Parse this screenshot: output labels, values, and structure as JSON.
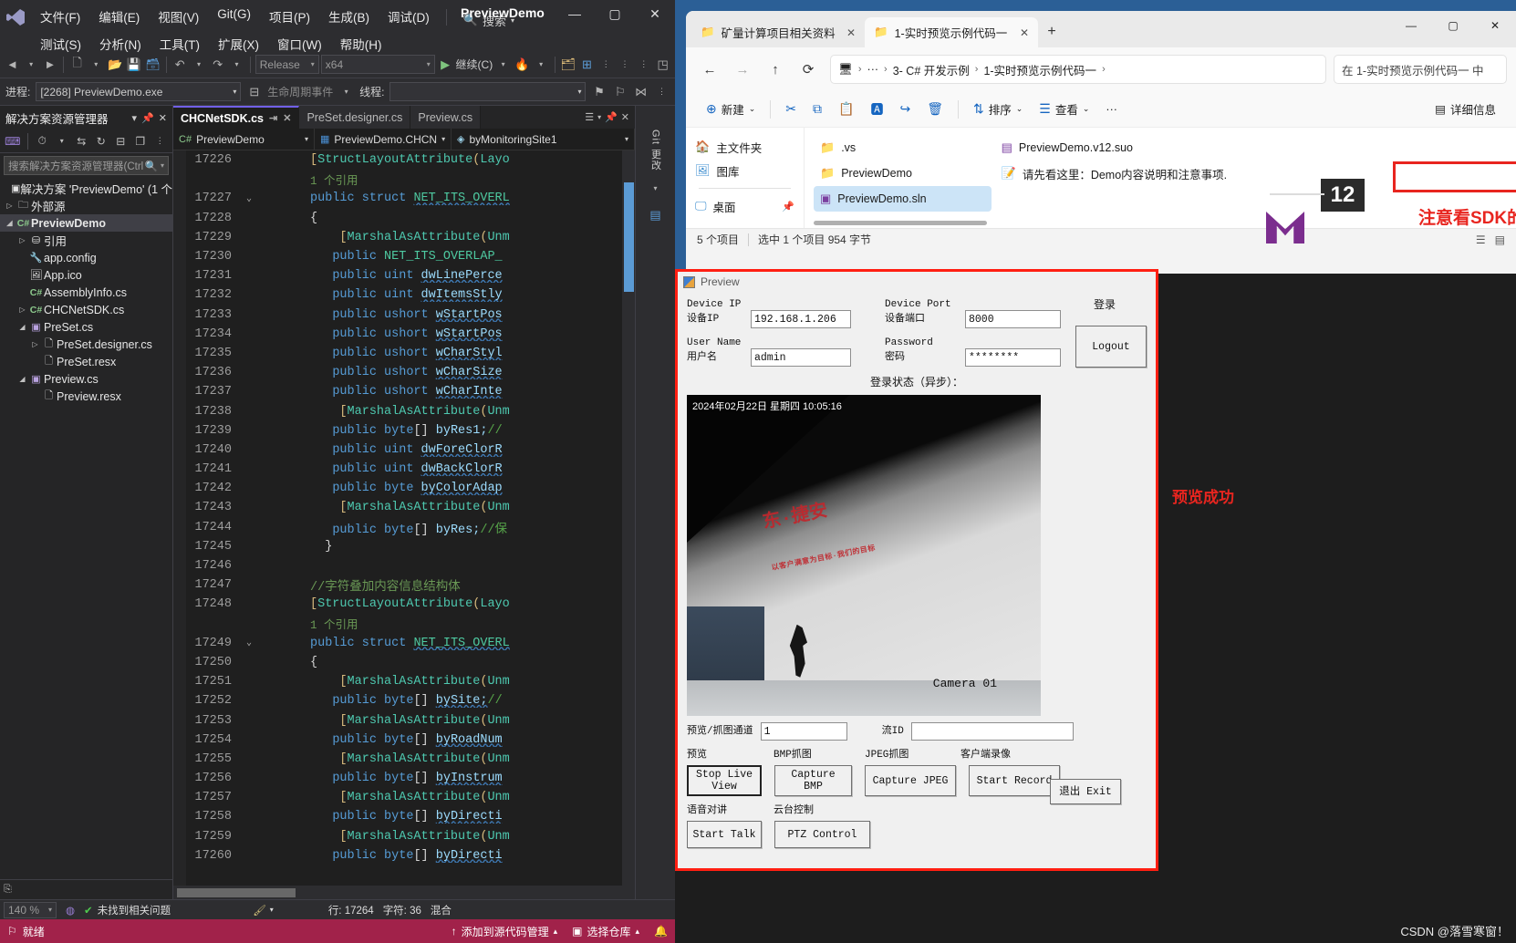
{
  "vs": {
    "title": "PreviewDemo",
    "menus_row1": [
      "文件(F)",
      "编辑(E)",
      "视图(V)",
      "Git(G)",
      "项目(P)",
      "生成(B)",
      "调试(D)"
    ],
    "menus_row2": [
      "测试(S)",
      "分析(N)",
      "工具(T)",
      "扩展(X)",
      "窗口(W)",
      "帮助(H)"
    ],
    "search_label": "搜索",
    "window_buttons": {
      "minimize": "—",
      "maximize": "▢",
      "close": "✕"
    },
    "toolbar": {
      "config": "Release",
      "platform": "x64",
      "run_label": "继续(C)",
      "process_label": "进程:",
      "process_value": "[2268] PreviewDemo.exe",
      "lifecycle_label": "生命周期事件",
      "thread_label": "线程:"
    },
    "solution_explorer": {
      "title": "解决方案资源管理器",
      "search_placeholder": "搜索解决方案资源管理器(Ctrl",
      "tree": [
        {
          "label": "解决方案 'PreviewDemo' (1 个",
          "depth": 0,
          "arrow": "",
          "icon": "solution-icon",
          "selected": false
        },
        {
          "label": "外部源",
          "depth": 0,
          "arrow": "▷",
          "icon": "external-icon",
          "selected": false
        },
        {
          "label": "PreviewDemo",
          "depth": 0,
          "arrow": "◢",
          "icon": "csharp-icon",
          "selected": true
        },
        {
          "label": "引用",
          "depth": 1,
          "arrow": "▷",
          "icon": "references-icon",
          "selected": false
        },
        {
          "label": "app.config",
          "depth": 1,
          "arrow": "",
          "icon": "config-icon",
          "selected": false
        },
        {
          "label": "App.ico",
          "depth": 1,
          "arrow": "",
          "icon": "image-icon",
          "selected": false
        },
        {
          "label": "AssemblyInfo.cs",
          "depth": 1,
          "arrow": "",
          "icon": "csharp-icon",
          "selected": false
        },
        {
          "label": "CHCNetSDK.cs",
          "depth": 1,
          "arrow": "▷",
          "icon": "csharp-icon",
          "selected": false
        },
        {
          "label": "PreSet.cs",
          "depth": 1,
          "arrow": "◢",
          "icon": "form-icon",
          "selected": false
        },
        {
          "label": "PreSet.designer.cs",
          "depth": 2,
          "arrow": "▷",
          "icon": "file-icon",
          "selected": false
        },
        {
          "label": "PreSet.resx",
          "depth": 2,
          "arrow": "",
          "icon": "file-icon",
          "selected": false
        },
        {
          "label": "Preview.cs",
          "depth": 1,
          "arrow": "◢",
          "icon": "form-icon",
          "selected": false
        },
        {
          "label": "Preview.resx",
          "depth": 2,
          "arrow": "",
          "icon": "file-icon",
          "selected": false
        }
      ]
    },
    "editor": {
      "tabs": [
        {
          "label": "CHCNetSDK.cs",
          "active": true
        },
        {
          "label": "PreSet.designer.cs",
          "active": false
        },
        {
          "label": "Preview.cs",
          "active": false
        }
      ],
      "nav": [
        {
          "label": "PreviewDemo",
          "icon": "csharp-icon"
        },
        {
          "label": "PreviewDemo.CHCN",
          "icon": "class-icon"
        },
        {
          "label": "byMonitoringSite1",
          "icon": "field-icon"
        }
      ],
      "zoom": "140 %",
      "issues": "未找到相关问题",
      "line_label": "行: 17264",
      "char_label": "字符: 36",
      "mode_label": "混合",
      "lines": [
        {
          "n": "17226",
          "fold": "",
          "html": "<span class='k-yellow'>[</span><span class='k-teal'>StructLayoutAttribute</span><span class='k-yellow'>(</span><span class='k-teal'>Layo</span>"
        },
        {
          "n": "",
          "fold": "",
          "html": "<span class='ref-lens'>1 个引用</span>"
        },
        {
          "n": "17227",
          "fold": "⌄",
          "html": "<span class='k-blue'>public</span> <span class='k-blue'>struct</span> <span class='k-green squig'>NET_ITS_OVERL</span>"
        },
        {
          "n": "17228",
          "fold": "",
          "html": "<span class='k-white'>{</span>"
        },
        {
          "n": "17229",
          "fold": "",
          "html": "    <span class='k-yellow'>[</span><span class='k-teal'>MarshalAsAttribute</span><span class='k-yellow'>(</span><span class='k-teal'>Unm</span>"
        },
        {
          "n": "17230",
          "fold": "",
          "html": "   <span class='k-blue'>public</span> <span class='k-green'>NET_ITS_OVERLAP_</span>"
        },
        {
          "n": "17231",
          "fold": "",
          "html": "   <span class='k-blue'>public</span> <span class='k-blue'>uint</span> <span class='k-var squig'>dwLinePerce</span>"
        },
        {
          "n": "17232",
          "fold": "",
          "html": "   <span class='k-blue'>public</span> <span class='k-blue'>uint</span> <span class='k-var squig'>dwItemsStly</span>"
        },
        {
          "n": "17233",
          "fold": "",
          "html": "   <span class='k-blue'>public</span> <span class='k-blue'>ushort</span> <span class='k-var squig'>wStartPos</span>"
        },
        {
          "n": "17234",
          "fold": "",
          "html": "   <span class='k-blue'>public</span> <span class='k-blue'>ushort</span> <span class='k-var squig'>wStartPos</span>"
        },
        {
          "n": "17235",
          "fold": "",
          "html": "   <span class='k-blue'>public</span> <span class='k-blue'>ushort</span> <span class='k-var squig'>wCharStyl</span>"
        },
        {
          "n": "17236",
          "fold": "",
          "html": "   <span class='k-blue'>public</span> <span class='k-blue'>ushort</span> <span class='k-var squig'>wCharSize</span>"
        },
        {
          "n": "17237",
          "fold": "",
          "html": "   <span class='k-blue'>public</span> <span class='k-blue'>ushort</span> <span class='k-var squig'>wCharInte</span>"
        },
        {
          "n": "17238",
          "fold": "",
          "html": "    <span class='k-yellow'>[</span><span class='k-teal'>MarshalAsAttribute</span><span class='k-yellow'>(</span><span class='k-teal'>Unm</span>"
        },
        {
          "n": "17239",
          "fold": "",
          "html": "   <span class='k-blue'>public</span> <span class='k-blue'>byte</span><span class='k-white'>[]</span> <span class='k-var'>byRes1;</span><span class='k-lgreen'>//</span>"
        },
        {
          "n": "17240",
          "fold": "",
          "html": "   <span class='k-blue'>public</span> <span class='k-blue'>uint</span> <span class='k-var squig'>dwForeClorR</span>"
        },
        {
          "n": "17241",
          "fold": "",
          "html": "   <span class='k-blue'>public</span> <span class='k-blue'>uint</span> <span class='k-var squig'>dwBackClorR</span>"
        },
        {
          "n": "17242",
          "fold": "",
          "html": "   <span class='k-blue'>public</span> <span class='k-blue'>byte</span> <span class='k-var squig'>byColorAdap</span>"
        },
        {
          "n": "17243",
          "fold": "",
          "html": "    <span class='k-yellow'>[</span><span class='k-teal'>MarshalAsAttribute</span><span class='k-yellow'>(</span><span class='k-teal'>Unm</span>"
        },
        {
          "n": "17244",
          "fold": "",
          "html": "   <span class='k-blue'>public</span> <span class='k-blue'>byte</span><span class='k-white'>[]</span> <span class='k-var'>byRes;</span><span class='k-lgreen'>//保</span>"
        },
        {
          "n": "17245",
          "fold": "",
          "html": "  <span class='k-white'>}</span>"
        },
        {
          "n": "17246",
          "fold": "",
          "html": ""
        },
        {
          "n": "17247",
          "fold": "",
          "html": "<span class='k-com'>//字符叠加内容信息结构体</span>"
        },
        {
          "n": "17248",
          "fold": "",
          "html": "<span class='k-yellow'>[</span><span class='k-teal'>StructLayoutAttribute</span><span class='k-yellow'>(</span><span class='k-teal'>Layo</span>"
        },
        {
          "n": "",
          "fold": "",
          "html": "<span class='ref-lens'>1 个引用</span>"
        },
        {
          "n": "17249",
          "fold": "⌄",
          "html": "<span class='k-blue'>public</span> <span class='k-blue'>struct</span> <span class='k-green squig'>NET_ITS_OVERL</span>"
        },
        {
          "n": "17250",
          "fold": "",
          "html": "<span class='k-white'>{</span>"
        },
        {
          "n": "17251",
          "fold": "",
          "html": "    <span class='k-yellow'>[</span><span class='k-teal'>MarshalAsAttribute</span><span class='k-yellow'>(</span><span class='k-teal'>Unm</span>"
        },
        {
          "n": "17252",
          "fold": "",
          "html": "   <span class='k-blue'>public</span> <span class='k-blue'>byte</span><span class='k-white'>[]</span> <span class='k-var squig'>bySite;</span><span class='k-lgreen'>//</span>"
        },
        {
          "n": "17253",
          "fold": "",
          "html": "    <span class='k-yellow'>[</span><span class='k-teal'>MarshalAsAttribute</span><span class='k-yellow'>(</span><span class='k-teal'>Unm</span>"
        },
        {
          "n": "17254",
          "fold": "",
          "html": "   <span class='k-blue'>public</span> <span class='k-blue'>byte</span><span class='k-white'>[]</span> <span class='k-var squig'>byRoadNum</span>"
        },
        {
          "n": "17255",
          "fold": "",
          "html": "    <span class='k-yellow'>[</span><span class='k-teal'>MarshalAsAttribute</span><span class='k-yellow'>(</span><span class='k-teal'>Unm</span>"
        },
        {
          "n": "17256",
          "fold": "",
          "html": "   <span class='k-blue'>public</span> <span class='k-blue'>byte</span><span class='k-white'>[]</span> <span class='k-var squig'>byInstrum</span>"
        },
        {
          "n": "17257",
          "fold": "",
          "html": "    <span class='k-yellow'>[</span><span class='k-teal'>MarshalAsAttribute</span><span class='k-yellow'>(</span><span class='k-teal'>Unm</span>"
        },
        {
          "n": "17258",
          "fold": "",
          "html": "   <span class='k-blue'>public</span> <span class='k-blue'>byte</span><span class='k-white'>[]</span> <span class='k-var squig'>byDirecti</span>"
        },
        {
          "n": "17259",
          "fold": "",
          "html": "    <span class='k-yellow'>[</span><span class='k-teal'>MarshalAsAttribute</span><span class='k-yellow'>(</span><span class='k-teal'>Unm</span>"
        },
        {
          "n": "17260",
          "fold": "",
          "html": "   <span class='k-blue'>public</span> <span class='k-blue'>byte</span><span class='k-white'>[]</span> <span class='k-var squig'>byDirecti</span>"
        }
      ]
    },
    "status_bar": {
      "ready": "就绪",
      "source_control": "添加到源代码管理",
      "select_repo": "选择仓库"
    },
    "right_strip": {
      "git_label": "Git 更改"
    }
  },
  "explorer": {
    "tabs": [
      {
        "label": "矿量计算项目相关资料",
        "active": false
      },
      {
        "label": "1-实时预览示例代码一",
        "active": true
      }
    ],
    "new_tab": "+",
    "window_buttons": {
      "minimize": "—",
      "maximize": "▢",
      "close": "✕"
    },
    "breadcrumb": [
      "3- C# 开发示例",
      "1-实时预览示例代码一"
    ],
    "search_placeholder": "在 1-实时预览示例代码一 中",
    "toolbar": {
      "new_label": "新建",
      "sort_label": "排序",
      "view_label": "查看",
      "more_label": "···",
      "details_label": "详细信息"
    },
    "sidebar": [
      {
        "label": "主文件夹",
        "icon": "home-icon"
      },
      {
        "label": "图库",
        "icon": "gallery-icon"
      },
      {
        "label": "桌面",
        "icon": "desktop-icon",
        "pinned": true
      }
    ],
    "files_col1": [
      {
        "label": ".vs",
        "icon": "folder-icon",
        "selected": false
      },
      {
        "label": "PreviewDemo",
        "icon": "folder-icon",
        "selected": false
      },
      {
        "label": "PreviewDemo.sln",
        "icon": "sln-icon",
        "selected": true
      }
    ],
    "files_col2": [
      {
        "label": "PreviewDemo.v12.suo",
        "icon": "suo-icon",
        "selected": false
      },
      {
        "label": "请先看这里：Demo内容说明和注意事项.",
        "icon": "text-icon",
        "selected": false
      }
    ],
    "annotation_note": "注意看SDK的配置说明",
    "status": {
      "count": "5 个项目",
      "selection": "选中 1 个项目  954 字节"
    },
    "bg_badge": "12"
  },
  "preview": {
    "window_title": "Preview",
    "window_buttons": {
      "minimize": "—",
      "maximize": "▢",
      "close": "✕"
    },
    "fields": {
      "device_ip_en": "Device IP",
      "device_ip_cn": "设备IP",
      "device_ip_value": "192.168.1.206",
      "device_port_en": "Device Port",
      "device_port_cn": "设备端口",
      "device_port_value": "8000",
      "user_name_en": "User Name",
      "user_name_cn": "用户名",
      "user_name_value": "admin",
      "password_en": "Password",
      "password_cn": "密码",
      "password_value": "********",
      "login_label": "登录",
      "logout_button": "Logout",
      "login_status": "登录状态（异步）："
    },
    "video": {
      "timestamp": "2024年02月22日 星期四 10:05:16",
      "camera": "Camera 01",
      "banner_text": "东·捷安",
      "banner_sub": "以客户满意为目标·我们的目标"
    },
    "channel": {
      "channel_label": "预览/抓图通道",
      "channel_value": "1",
      "stream_label": "流ID",
      "stream_value": ""
    },
    "groups": {
      "preview_label": "预览",
      "bmp_label": "BMP抓图",
      "jpeg_label": "JPEG抓图",
      "record_label": "客户端录像",
      "talk_label": "语音对讲",
      "ptz_label": "云台控制"
    },
    "buttons": {
      "stop_live_view": "Stop Live\nView",
      "capture_bmp": "Capture\nBMP",
      "capture_jpeg": "Capture JPEG",
      "start_record": "Start Record",
      "start_talk": "Start Talk",
      "ptz_control": "PTZ Control",
      "exit": "退出 Exit"
    },
    "annotation_success": "预览成功"
  },
  "watermark": "CSDN @落雪寒窗！"
}
